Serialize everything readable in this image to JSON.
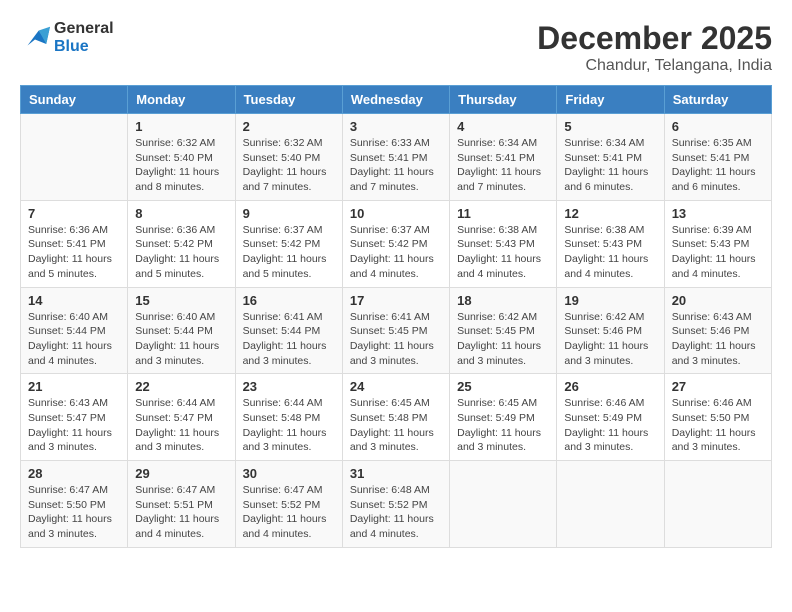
{
  "logo": {
    "line1": "General",
    "line2": "Blue"
  },
  "title": "December 2025",
  "location": "Chandur, Telangana, India",
  "days_of_week": [
    "Sunday",
    "Monday",
    "Tuesday",
    "Wednesday",
    "Thursday",
    "Friday",
    "Saturday"
  ],
  "weeks": [
    [
      {
        "day": "",
        "info": ""
      },
      {
        "day": "1",
        "info": "Sunrise: 6:32 AM\nSunset: 5:40 PM\nDaylight: 11 hours\nand 8 minutes."
      },
      {
        "day": "2",
        "info": "Sunrise: 6:32 AM\nSunset: 5:40 PM\nDaylight: 11 hours\nand 7 minutes."
      },
      {
        "day": "3",
        "info": "Sunrise: 6:33 AM\nSunset: 5:41 PM\nDaylight: 11 hours\nand 7 minutes."
      },
      {
        "day": "4",
        "info": "Sunrise: 6:34 AM\nSunset: 5:41 PM\nDaylight: 11 hours\nand 7 minutes."
      },
      {
        "day": "5",
        "info": "Sunrise: 6:34 AM\nSunset: 5:41 PM\nDaylight: 11 hours\nand 6 minutes."
      },
      {
        "day": "6",
        "info": "Sunrise: 6:35 AM\nSunset: 5:41 PM\nDaylight: 11 hours\nand 6 minutes."
      }
    ],
    [
      {
        "day": "7",
        "info": "Sunrise: 6:36 AM\nSunset: 5:41 PM\nDaylight: 11 hours\nand 5 minutes."
      },
      {
        "day": "8",
        "info": "Sunrise: 6:36 AM\nSunset: 5:42 PM\nDaylight: 11 hours\nand 5 minutes."
      },
      {
        "day": "9",
        "info": "Sunrise: 6:37 AM\nSunset: 5:42 PM\nDaylight: 11 hours\nand 5 minutes."
      },
      {
        "day": "10",
        "info": "Sunrise: 6:37 AM\nSunset: 5:42 PM\nDaylight: 11 hours\nand 4 minutes."
      },
      {
        "day": "11",
        "info": "Sunrise: 6:38 AM\nSunset: 5:43 PM\nDaylight: 11 hours\nand 4 minutes."
      },
      {
        "day": "12",
        "info": "Sunrise: 6:38 AM\nSunset: 5:43 PM\nDaylight: 11 hours\nand 4 minutes."
      },
      {
        "day": "13",
        "info": "Sunrise: 6:39 AM\nSunset: 5:43 PM\nDaylight: 11 hours\nand 4 minutes."
      }
    ],
    [
      {
        "day": "14",
        "info": "Sunrise: 6:40 AM\nSunset: 5:44 PM\nDaylight: 11 hours\nand 4 minutes."
      },
      {
        "day": "15",
        "info": "Sunrise: 6:40 AM\nSunset: 5:44 PM\nDaylight: 11 hours\nand 3 minutes."
      },
      {
        "day": "16",
        "info": "Sunrise: 6:41 AM\nSunset: 5:44 PM\nDaylight: 11 hours\nand 3 minutes."
      },
      {
        "day": "17",
        "info": "Sunrise: 6:41 AM\nSunset: 5:45 PM\nDaylight: 11 hours\nand 3 minutes."
      },
      {
        "day": "18",
        "info": "Sunrise: 6:42 AM\nSunset: 5:45 PM\nDaylight: 11 hours\nand 3 minutes."
      },
      {
        "day": "19",
        "info": "Sunrise: 6:42 AM\nSunset: 5:46 PM\nDaylight: 11 hours\nand 3 minutes."
      },
      {
        "day": "20",
        "info": "Sunrise: 6:43 AM\nSunset: 5:46 PM\nDaylight: 11 hours\nand 3 minutes."
      }
    ],
    [
      {
        "day": "21",
        "info": "Sunrise: 6:43 AM\nSunset: 5:47 PM\nDaylight: 11 hours\nand 3 minutes."
      },
      {
        "day": "22",
        "info": "Sunrise: 6:44 AM\nSunset: 5:47 PM\nDaylight: 11 hours\nand 3 minutes."
      },
      {
        "day": "23",
        "info": "Sunrise: 6:44 AM\nSunset: 5:48 PM\nDaylight: 11 hours\nand 3 minutes."
      },
      {
        "day": "24",
        "info": "Sunrise: 6:45 AM\nSunset: 5:48 PM\nDaylight: 11 hours\nand 3 minutes."
      },
      {
        "day": "25",
        "info": "Sunrise: 6:45 AM\nSunset: 5:49 PM\nDaylight: 11 hours\nand 3 minutes."
      },
      {
        "day": "26",
        "info": "Sunrise: 6:46 AM\nSunset: 5:49 PM\nDaylight: 11 hours\nand 3 minutes."
      },
      {
        "day": "27",
        "info": "Sunrise: 6:46 AM\nSunset: 5:50 PM\nDaylight: 11 hours\nand 3 minutes."
      }
    ],
    [
      {
        "day": "28",
        "info": "Sunrise: 6:47 AM\nSunset: 5:50 PM\nDaylight: 11 hours\nand 3 minutes."
      },
      {
        "day": "29",
        "info": "Sunrise: 6:47 AM\nSunset: 5:51 PM\nDaylight: 11 hours\nand 4 minutes."
      },
      {
        "day": "30",
        "info": "Sunrise: 6:47 AM\nSunset: 5:52 PM\nDaylight: 11 hours\nand 4 minutes."
      },
      {
        "day": "31",
        "info": "Sunrise: 6:48 AM\nSunset: 5:52 PM\nDaylight: 11 hours\nand 4 minutes."
      },
      {
        "day": "",
        "info": ""
      },
      {
        "day": "",
        "info": ""
      },
      {
        "day": "",
        "info": ""
      }
    ]
  ]
}
